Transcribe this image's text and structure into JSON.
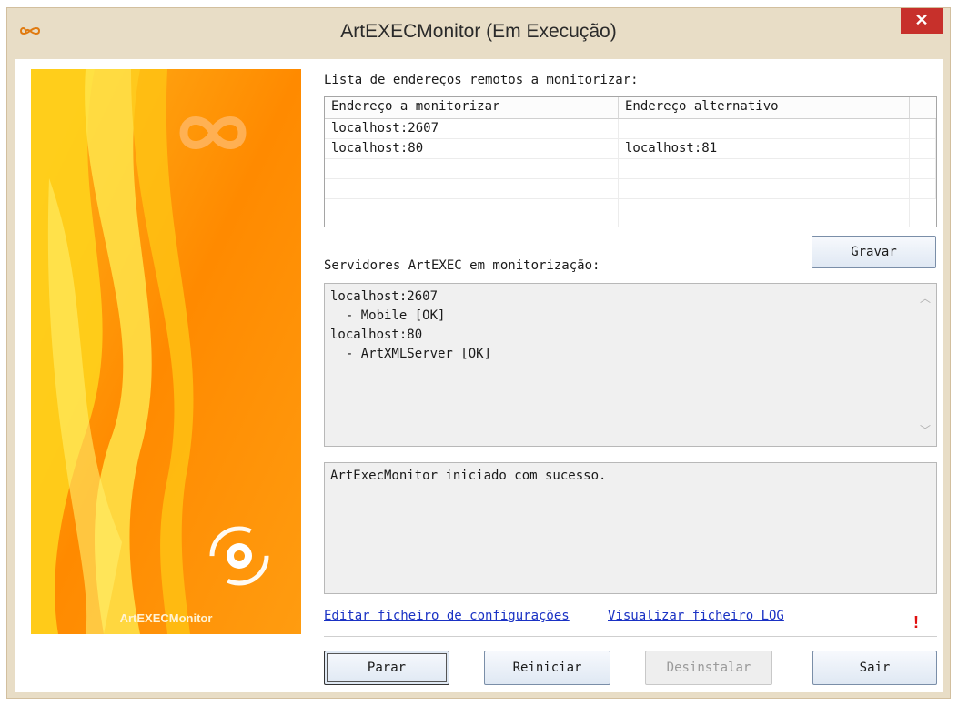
{
  "window": {
    "title": "ArtEXECMonitor (Em Execução)",
    "close_glyph": "✕",
    "app_icon": "infinity-icon"
  },
  "banner": {
    "caption": "ArtEXECMonitor",
    "colors": {
      "orange": "#ff9500",
      "yellow": "#ffd21c"
    }
  },
  "addresses": {
    "label": "Lista de endereços remotos a monitorizar:",
    "columns": [
      "Endereço a monitorizar",
      "Endereço alternativo"
    ],
    "rows": [
      [
        "localhost:2607",
        ""
      ],
      [
        "localhost:80",
        "localhost:81"
      ],
      [
        "",
        ""
      ],
      [
        "",
        ""
      ]
    ]
  },
  "save_button": "Gravar",
  "servers": {
    "label": "Servidores ArtEXEC em monitorização:",
    "lines": [
      "localhost:2607",
      "  - Mobile [OK]",
      "localhost:80",
      "  - ArtXMLServer [OK]"
    ]
  },
  "log": {
    "text": "ArtExecMonitor iniciado com sucesso."
  },
  "links": {
    "edit_config": "Editar ficheiro de configurações",
    "view_log": "Visualizar ficheiro LOG",
    "warning": "!"
  },
  "buttons": {
    "stop": "Parar",
    "restart": "Reiniciar",
    "uninstall": "Desinstalar",
    "exit": "Sair"
  }
}
